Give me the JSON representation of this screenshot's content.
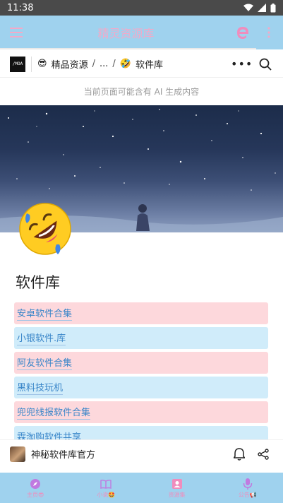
{
  "status": {
    "time": "11:38"
  },
  "appbar": {
    "title": "精灵资源库"
  },
  "breadcrumb": {
    "logo_text": "/MOA",
    "items": [
      {
        "emoji": "😎",
        "label": "精品资源"
      },
      {
        "label": "..."
      },
      {
        "emoji": "🤣",
        "label": "软件库"
      }
    ],
    "separator": "/",
    "more": "•••"
  },
  "ai_notice": "当前页面可能含有 AI 生成内容",
  "page": {
    "title": "软件库",
    "icon": "rolling-on-floor-laughing-emoji"
  },
  "links": [
    {
      "label": "安卓软件合集",
      "color": "pink"
    },
    {
      "label": "小银软件.库",
      "color": "blue"
    },
    {
      "label": "阿友软件合集",
      "color": "pink"
    },
    {
      "label": "黑料技玩机",
      "color": "blue"
    },
    {
      "label": "兜兜线报软件合集",
      "color": "pink"
    },
    {
      "label": "霖淘购软件共享",
      "color": "blue"
    }
  ],
  "author": {
    "name": "神秘软件库官方"
  },
  "bottom_nav": [
    {
      "label": "主页😎",
      "icon": "compass-icon"
    },
    {
      "label": "小说🤩",
      "icon": "book-icon"
    },
    {
      "label": "资源集",
      "icon": "contact-icon"
    },
    {
      "label": "公告📢",
      "icon": "microphone-icon"
    }
  ],
  "colors": {
    "appbar": "#9fd2ee",
    "title_pink": "#f3a9c8",
    "link_pink": "#fdd8dc",
    "link_blue": "#d0ecfa"
  }
}
